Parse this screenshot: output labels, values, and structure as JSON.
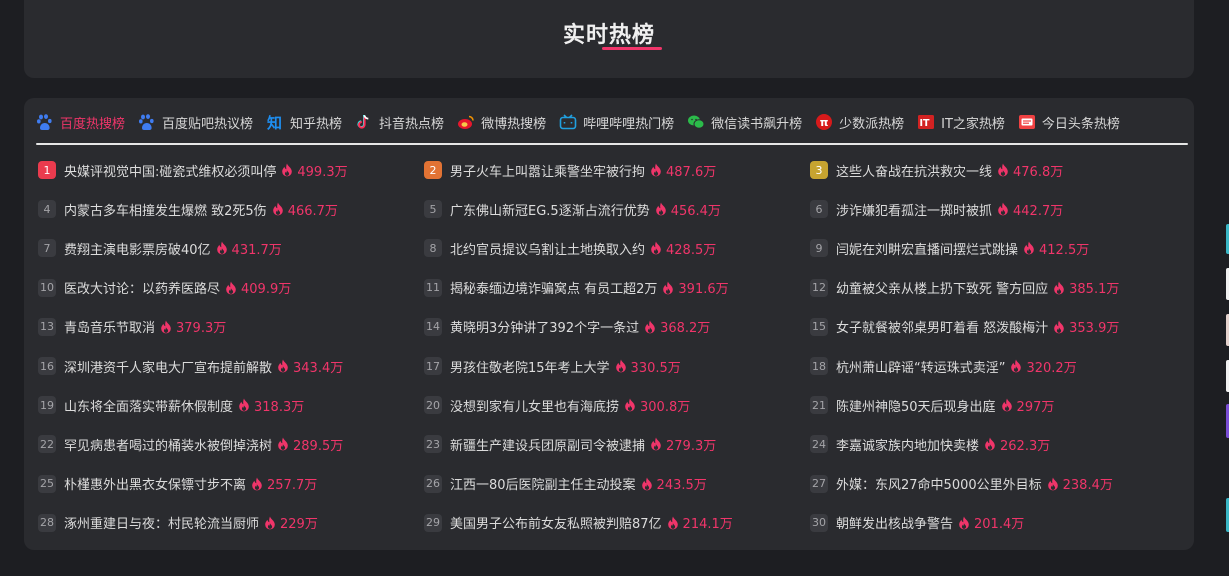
{
  "header": {
    "title": "实时热榜"
  },
  "tabs": [
    {
      "label": "百度热搜榜",
      "icon": "baidu-paw-icon",
      "active": true
    },
    {
      "label": "百度贴吧热议榜",
      "icon": "baidu-paw-icon"
    },
    {
      "label": "知乎热榜",
      "icon": "zhihu-icon"
    },
    {
      "label": "抖音热点榜",
      "icon": "douyin-icon"
    },
    {
      "label": "微博热搜榜",
      "icon": "weibo-icon"
    },
    {
      "label": "哔哩哔哩热门榜",
      "icon": "bilibili-icon"
    },
    {
      "label": "微信读书飙升榜",
      "icon": "wechat-icon"
    },
    {
      "label": "少数派热榜",
      "icon": "sspai-icon"
    },
    {
      "label": "IT之家热榜",
      "icon": "ithome-icon"
    },
    {
      "label": "今日头条热榜",
      "icon": "toutiao-icon"
    }
  ],
  "items": [
    {
      "rank": "1",
      "title": "央媒评视觉中国:碰瓷式维权必须叫停",
      "heat": "499.3万"
    },
    {
      "rank": "2",
      "title": "男子火车上叫嚣让乘警坐牢被行拘",
      "heat": "487.6万"
    },
    {
      "rank": "3",
      "title": "这些人奋战在抗洪救灾一线",
      "heat": "476.8万"
    },
    {
      "rank": "4",
      "title": "内蒙古多车相撞发生爆燃 致2死5伤",
      "heat": "466.7万"
    },
    {
      "rank": "5",
      "title": "广东佛山新冠EG.5逐渐占流行优势",
      "heat": "456.4万"
    },
    {
      "rank": "6",
      "title": "涉诈嫌犯看孤注一掷时被抓",
      "heat": "442.7万"
    },
    {
      "rank": "7",
      "title": "费翔主演电影票房破40亿",
      "heat": "431.7万"
    },
    {
      "rank": "8",
      "title": "北约官员提议乌割让土地换取入约",
      "heat": "428.5万"
    },
    {
      "rank": "9",
      "title": "闫妮在刘畊宏直播间摆烂式跳操",
      "heat": "412.5万"
    },
    {
      "rank": "10",
      "title": "医改大讨论：以药养医路尽",
      "heat": "409.9万"
    },
    {
      "rank": "11",
      "title": "揭秘泰缅边境诈骗窝点 有员工超2万",
      "heat": "391.6万"
    },
    {
      "rank": "12",
      "title": "幼童被父亲从楼上扔下致死 警方回应",
      "heat": "385.1万"
    },
    {
      "rank": "13",
      "title": "青岛音乐节取消",
      "heat": "379.3万"
    },
    {
      "rank": "14",
      "title": "黄晓明3分钟讲了392个字一条过",
      "heat": "368.2万"
    },
    {
      "rank": "15",
      "title": "女子就餐被邻桌男盯着看 怒泼酸梅汁",
      "heat": "353.9万"
    },
    {
      "rank": "16",
      "title": "深圳港资千人家电大厂宣布提前解散",
      "heat": "343.4万"
    },
    {
      "rank": "17",
      "title": "男孩住敬老院15年考上大学",
      "heat": "330.5万"
    },
    {
      "rank": "18",
      "title": "杭州萧山辟谣“转运珠式卖淫”",
      "heat": "320.2万"
    },
    {
      "rank": "19",
      "title": "山东将全面落实带薪休假制度",
      "heat": "318.3万"
    },
    {
      "rank": "20",
      "title": "没想到家有儿女里也有海底捞",
      "heat": "300.8万"
    },
    {
      "rank": "21",
      "title": "陈建州神隐50天后现身出庭",
      "heat": "297万"
    },
    {
      "rank": "22",
      "title": "罕见病患者喝过的桶装水被倒掉浇树",
      "heat": "289.5万"
    },
    {
      "rank": "23",
      "title": "新疆生产建设兵团原副司令被逮捕",
      "heat": "279.3万"
    },
    {
      "rank": "24",
      "title": "李嘉诚家族内地加快卖楼",
      "heat": "262.3万"
    },
    {
      "rank": "25",
      "title": "朴槿惠外出黑衣女保镖寸步不离",
      "heat": "257.7万"
    },
    {
      "rank": "26",
      "title": "江西一80后医院副主任主动投案",
      "heat": "243.5万"
    },
    {
      "rank": "27",
      "title": "外媒：东风27命中5000公里外目标",
      "heat": "238.4万"
    },
    {
      "rank": "28",
      "title": "涿州重建日与夜：村民轮流当厨师",
      "heat": "229万"
    },
    {
      "rank": "29",
      "title": "美国男子公布前女友私照被判赔87亿",
      "heat": "214.1万"
    },
    {
      "rank": "30",
      "title": "朝鲜发出核战争警告",
      "heat": "201.4万"
    }
  ],
  "colors": {
    "accent": "#f0356a",
    "rank1": "#ea3b4e",
    "rank2": "#e27334",
    "rank3": "#c7a430"
  }
}
